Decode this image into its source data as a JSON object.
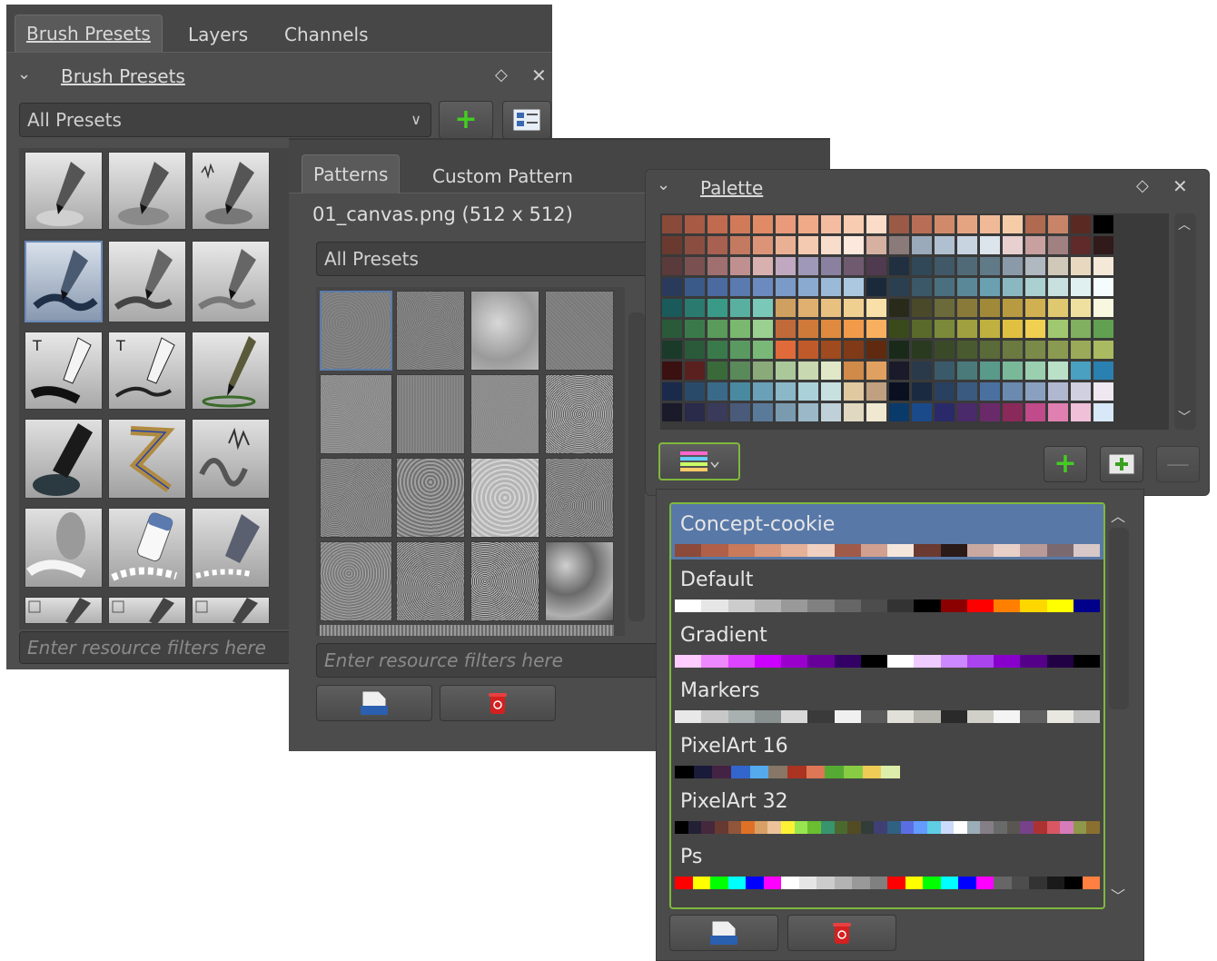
{
  "brush_docker": {
    "tabs": [
      "Brush Presets",
      "Layers",
      "Channels"
    ],
    "title": "Brush Presets",
    "preset_filter": "All Presets",
    "search_placeholder": "Enter resource filters here"
  },
  "patterns_docker": {
    "tabs": [
      "Patterns",
      "Custom Pattern"
    ],
    "selected_info": "01_canvas.png (512 x 512)",
    "preset_filter": "All Presets",
    "search_placeholder": "Enter resource filters here"
  },
  "palette_docker": {
    "title": "Palette",
    "palettes": [
      {
        "name": "Concept-cookie",
        "colors": [
          "#8b4a3a",
          "#b06048",
          "#c97a5a",
          "#d9967a",
          "#e6b199",
          "#f0d0c0",
          "#a05a4a",
          "#d2a090",
          "#f5e6dc",
          "#6b3a30",
          "#2a1a18",
          "#c8a8a0",
          "#e8d0c8",
          "#b89a98",
          "#7a6a70",
          "#d8c8c8"
        ]
      },
      {
        "name": "Default",
        "colors": [
          "#ffffff",
          "#e6e6e6",
          "#cccccc",
          "#b3b3b3",
          "#999999",
          "#808080",
          "#666666",
          "#4d4d4d",
          "#333333",
          "#000000",
          "#8b0000",
          "#ff0000",
          "#ff8000",
          "#ffd700",
          "#ffff00",
          "#00008b"
        ]
      },
      {
        "name": "Gradient",
        "colors": [
          "#ffccff",
          "#ee88ff",
          "#dd44ff",
          "#cc00ff",
          "#9900cc",
          "#660099",
          "#330066",
          "#000000",
          "#ffffff",
          "#eeccff",
          "#cc88ff",
          "#aa44ee",
          "#8800cc",
          "#550088",
          "#220044",
          "#000000"
        ]
      },
      {
        "name": "Markers",
        "colors": [
          "#e8e8e8",
          "#c8c8c8",
          "#a8b0b0",
          "#889090",
          "#d8d8d8",
          "#3a3a3a",
          "#f0f0f0",
          "#5a5a5a",
          "#e0e0d8",
          "#b8b8b0",
          "#2a2a2a",
          "#d0d0c8",
          "#f4f4f4",
          "#606060",
          "#e8e8e0",
          "#c0c0c0"
        ]
      },
      {
        "name": "PixelArt 16",
        "colors": [
          "#000000",
          "#1a1a3a",
          "#442244",
          "#3366cc",
          "#55aaee",
          "#887766",
          "#aa3322",
          "#dd7755",
          "#55aa33",
          "#88cc44",
          "#eecc55",
          "#ddeeaa"
        ]
      },
      {
        "name": "PixelArt 32",
        "colors": [
          "#000000",
          "#222034",
          "#45283c",
          "#663931",
          "#8f563b",
          "#df7126",
          "#d9a066",
          "#eec39a",
          "#fbf236",
          "#99e550",
          "#6abe30",
          "#37946e",
          "#4b692f",
          "#524b24",
          "#323c39",
          "#3f3f74",
          "#306082",
          "#5b6ee1",
          "#639bff",
          "#5fcde4",
          "#cbdbfc",
          "#ffffff",
          "#9badb7",
          "#847e87",
          "#696a6a",
          "#595652",
          "#76428a",
          "#ac3232",
          "#d95763",
          "#d77bba",
          "#8f974a",
          "#8a6f30"
        ]
      },
      {
        "name": "Ps",
        "colors": [
          "#ff0000",
          "#ffff00",
          "#00ff00",
          "#00ffff",
          "#0000ff",
          "#ff00ff",
          "#ffffff",
          "#e6e6e6",
          "#cccccc",
          "#b3b3b3",
          "#999999",
          "#808080",
          "#ff0000",
          "#ffff00",
          "#00ff00",
          "#00ffff",
          "#0000ff",
          "#ff00ff",
          "#666666",
          "#4d4d4d",
          "#333333",
          "#1a1a1a",
          "#000000",
          "#ff8040"
        ]
      }
    ]
  }
}
